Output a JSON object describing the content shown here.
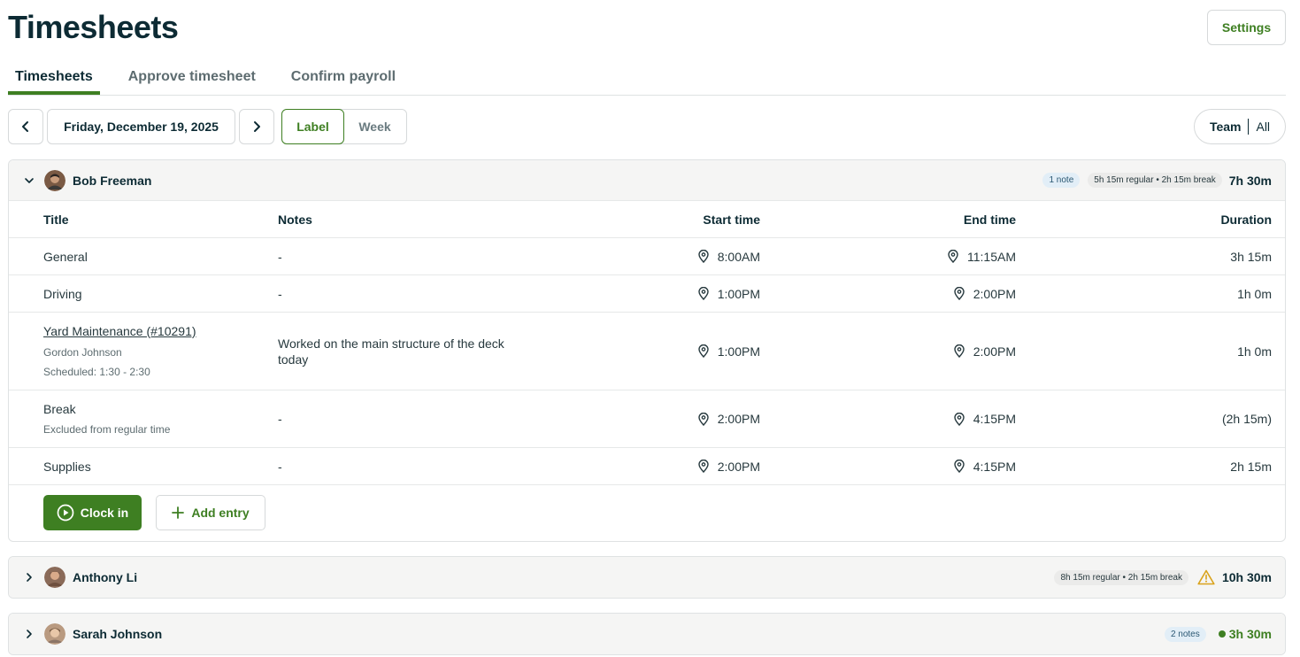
{
  "header": {
    "title": "Timesheets",
    "settings_label": "Settings"
  },
  "tabs": [
    {
      "label": "Timesheets",
      "active": true
    },
    {
      "label": "Approve timesheet",
      "active": false
    },
    {
      "label": "Confirm payroll",
      "active": false
    }
  ],
  "toolbar": {
    "date_label": "Friday, December 19, 2025",
    "view_options": [
      "Label",
      "Week"
    ],
    "selected_view": "Label",
    "scope_selected": "Team",
    "scope_other": "All"
  },
  "columns": {
    "title": "Title",
    "notes": "Notes",
    "start": "Start time",
    "end": "End time",
    "duration": "Duration"
  },
  "people": [
    {
      "name": "Bob Freeman",
      "expanded": true,
      "notes_pill": "1 note",
      "summary_pill": "5h 15m regular • 2h 15m break",
      "total": "7h 30m",
      "entries": [
        {
          "title": "General",
          "notes": "-",
          "start": "8:00AM",
          "end": "11:15AM",
          "duration": "3h 15m"
        },
        {
          "title": "Driving",
          "notes": "-",
          "start": "1:00PM",
          "end": "2:00PM",
          "duration": "1h 0m"
        },
        {
          "title": "Yard Maintenance (#10291)",
          "sub1": "Gordon Johnson",
          "sub2": "Scheduled: 1:30 - 2:30",
          "notes": "Worked on the main structure of the deck today",
          "start": "1:00PM",
          "end": "2:00PM",
          "duration": "1h 0m"
        },
        {
          "title": "Break",
          "sub1": "Excluded from regular time",
          "notes": "-",
          "start": "2:00PM",
          "end": "4:15PM",
          "duration": "(2h 15m)"
        },
        {
          "title": "Supplies",
          "notes": "-",
          "start": "2:00PM",
          "end": "4:15PM",
          "duration": "2h 15m"
        }
      ],
      "clock_in_label": "Clock in",
      "add_entry_label": "Add entry"
    },
    {
      "name": "Anthony Li",
      "expanded": false,
      "summary_pill": "8h 15m regular • 2h 15m break",
      "total": "10h 30m",
      "warning": true
    },
    {
      "name": "Sarah Johnson",
      "expanded": false,
      "notes_pill": "2 notes",
      "total": "3h 30m",
      "status_color": "#3e7f22"
    }
  ],
  "colors": {
    "accent": "#3e7f22",
    "warning": "#d9a21b",
    "title": "#0d2b34"
  }
}
